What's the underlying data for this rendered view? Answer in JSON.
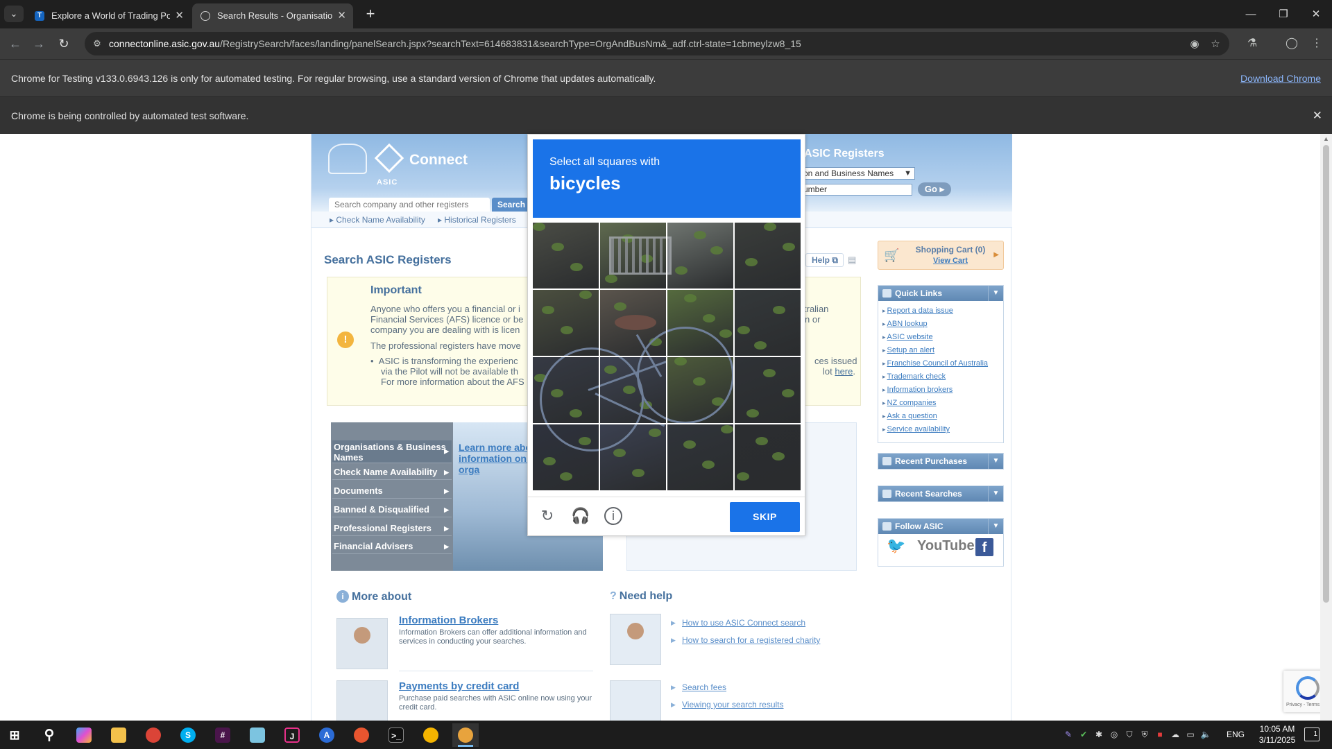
{
  "browser": {
    "tabs": [
      {
        "title": "Explore a World of Trading Pos",
        "favicon": "T"
      },
      {
        "title": "Search Results - Organisations",
        "favicon": ""
      }
    ],
    "url_host": "connectonline.asic.gov.au",
    "url_path": "/RegistrySearch/faces/landing/panelSearch.jspx?searchText=614683831&searchType=OrgAndBusNm&_adf.ctrl-state=1cbmeylzw8_15",
    "infobar_testing": "Chrome for Testing v133.0.6943.126 is only for automated testing. For regular browsing, use a standard version of Chrome that updates automatically.",
    "infobar_download": "Download Chrome",
    "infobar_automation": "Chrome is being controlled by automated test software."
  },
  "asic": {
    "brand": "Connect",
    "brand_sub": "ASIC",
    "search_placeholder": "Search company and other registers",
    "search_button": "Search",
    "registers_title": "ASIC Registers",
    "registers_select": "on and Business Names",
    "registers_input": "umber",
    "go_button": "Go",
    "subnav": [
      "Check Name Availability",
      "Historical Registers"
    ],
    "main_title": "Search ASIC Registers",
    "help": "Help",
    "important": {
      "title": "Important",
      "p1_l1": "Anyone who offers you a financial or i",
      "p1_l2": "Financial Services (AFS) licence or be",
      "p1_l3": "company you are dealing with is licen",
      "p1_r1": "tralian",
      "p1_r2": "n or",
      "p2": "The professional registers have move",
      "b1_l1": "ASIC is transforming the experienc",
      "b1_l2": "via the Pilot will not be available th",
      "b1_l3": "For more information about the AFS",
      "b1_r1": "ces issued",
      "b1_r2": "lot ",
      "b1_r2_link": "here"
    },
    "org_menu": [
      "Organisations & Business Names",
      "Check Name Availability",
      "Documents",
      "Banned & Disqualified",
      "Professional Registers",
      "Financial Advisers"
    ],
    "promo_learn": "Learn more abo information on and other orga",
    "more_about": "More about",
    "need_help": "Need help",
    "about_items": [
      {
        "title": "Information Brokers",
        "text": "Information Brokers can offer additional information and services in conducting your searches."
      },
      {
        "title": "Payments by credit card",
        "text": "Purchase paid searches with ASIC online now using your credit card."
      }
    ],
    "help_links": [
      "How to use ASIC Connect search",
      "How to search for a registered charity",
      "Search fees",
      "Viewing your search results"
    ],
    "cart_title": "Shopping Cart (0)",
    "cart_view": "View Cart",
    "quick_links_title": "Quick Links",
    "quick_links": [
      "Report a data issue",
      "ABN lookup",
      "ASIC website",
      "Setup an alert",
      "Franchise Council of Australia",
      "Trademark check",
      "Information brokers",
      "NZ companies",
      "Ask a question",
      "Service availability"
    ],
    "recent_purchases": "Recent Purchases",
    "recent_searches": "Recent Searches",
    "follow": "Follow ASIC",
    "youtube": "YouTube"
  },
  "captcha": {
    "line1": "Select all squares with",
    "line2": "bicycles",
    "skip": "SKIP"
  },
  "recaptcha_badge": "Privacy - Terms",
  "taskbar": {
    "lang": "ENG",
    "time": "10:05 AM",
    "date": "3/11/2025",
    "notifications": "1"
  }
}
